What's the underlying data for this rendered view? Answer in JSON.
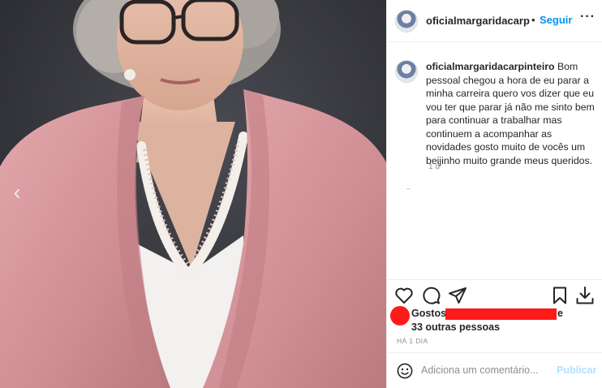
{
  "post": {
    "username_header": "oficialmargaridacarpinteiro",
    "dot": "•",
    "follow_label": "Seguir",
    "more_label": "···",
    "prev_arrow": "‹",
    "caption_username": "oficialmargaridacarpinteiro",
    "caption_text": " Bom pessoal chegou a hora de eu parar a minha carreira quero vos dizer que eu vou ter que parar já não me sinto bem para continuar a trabalhar mas continuem a acompanhar as novidades gosto muito de vocês um beijinho muito grande meus queridos.",
    "time_ago": "1 d"
  },
  "likes": {
    "label": "Gostos:",
    "and": "e",
    "others": "33 outras pessoas"
  },
  "date": "HÁ 1 DIA",
  "comment_box": {
    "placeholder": "Adiciona um comentário...",
    "publish_label": "Publicar"
  },
  "icons": {
    "like": "heart-icon",
    "comment": "comment-bubble-icon",
    "share": "paper-plane-icon",
    "save": "bookmark-icon",
    "download": "download-icon",
    "emoji": "smiley-icon",
    "prev": "chevron-left-icon"
  },
  "colors": {
    "accent": "#0095f6",
    "publish_disabled": "#b2dffc",
    "redaction": "#ff1a1a",
    "blazer": "#d99a9f",
    "backdrop": "#34353a"
  }
}
